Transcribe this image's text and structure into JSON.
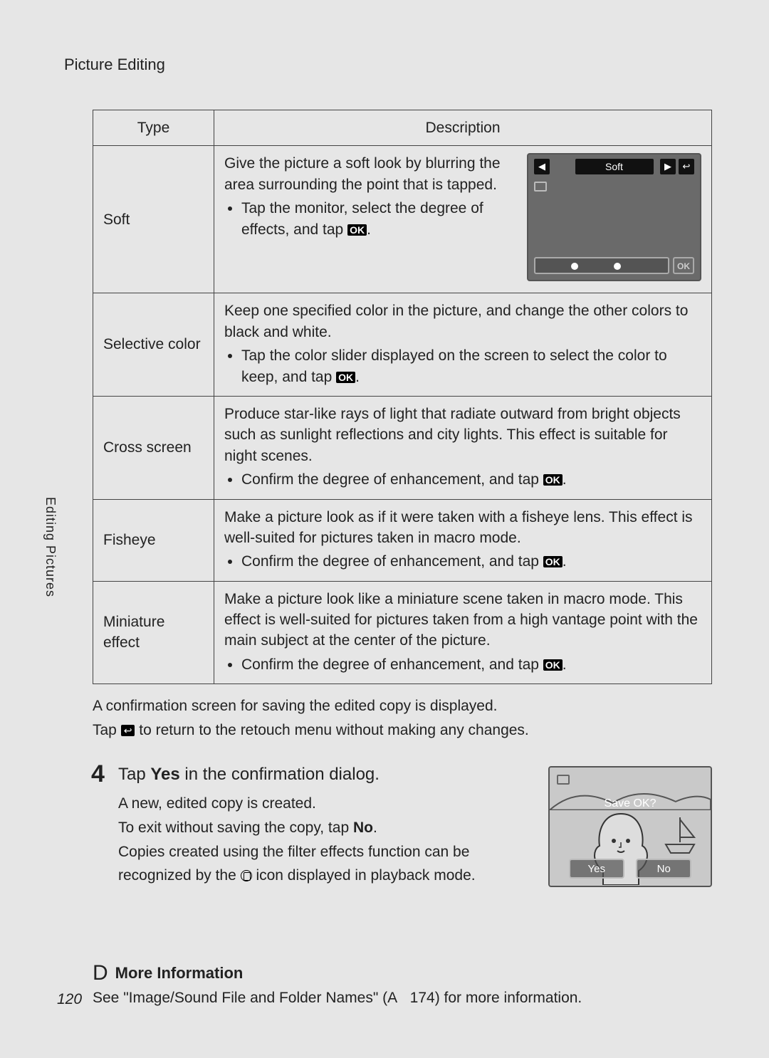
{
  "header": {
    "title": "Picture Editing"
  },
  "side_tab": "Editing Pictures",
  "table": {
    "col_type": "Type",
    "col_desc": "Description",
    "rows": {
      "soft": {
        "type": "Soft",
        "intro": "Give the picture a soft look by blurring the area surrounding the point that is tapped.",
        "bullet": "Tap the monitor, select the degree of effects, and tap ",
        "bullet_end": ".",
        "preview": {
          "title": "Soft",
          "ok": "OK"
        }
      },
      "selective": {
        "type": "Selective color",
        "intro": "Keep one specified color in the picture, and change the other colors to black and white.",
        "bullet": "Tap the color slider displayed on the screen to select the color to keep, and tap ",
        "bullet_end": "."
      },
      "cross": {
        "type": "Cross screen",
        "intro": "Produce star-like rays of light that radiate outward from bright objects such as sunlight reflections and city lights. This effect is suitable for night scenes.",
        "bullet": "Confirm the degree of enhancement, and tap ",
        "bullet_end": "."
      },
      "fisheye": {
        "type": "Fisheye",
        "intro": "Make a picture look as if it were taken with a fisheye lens. This effect is well-suited for pictures taken in macro mode.",
        "bullet": "Confirm the degree of enhancement, and tap ",
        "bullet_end": "."
      },
      "miniature": {
        "type": "Miniature effect",
        "intro": "Make a picture look like a miniature scene taken in macro mode. This effect is well-suited for pictures taken from a high vantage point with the main subject at the center of the picture.",
        "bullet": "Confirm the degree of enhancement, and tap ",
        "bullet_end": "."
      }
    }
  },
  "ok_label": "OK",
  "below": {
    "line1": "A confirmation screen for saving the edited copy is displayed.",
    "line2a": "Tap ",
    "line2b": " to return to the retouch menu without making any changes."
  },
  "step4": {
    "num": "4",
    "title_a": "Tap ",
    "title_b": "Yes",
    "title_c": " in the confirmation dialog.",
    "p1": "A new, edited copy is created.",
    "p2a": "To exit without saving the copy, tap ",
    "p2b": "No",
    "p2c": ".",
    "p3a": "Copies created using the filter effects function can be recognized by the ",
    "p3b": " icon displayed in playback mode.",
    "preview": {
      "ask": "Save OK?",
      "yes": "Yes",
      "no": "No"
    }
  },
  "moreinfo": {
    "d": "D",
    "heading": "More Information",
    "text_a": "See \"Image/Sound File and Folder Names\" (",
    "text_ref": "A",
    "text_pg": "174",
    "text_b": ") for more information."
  },
  "page_number": "120"
}
